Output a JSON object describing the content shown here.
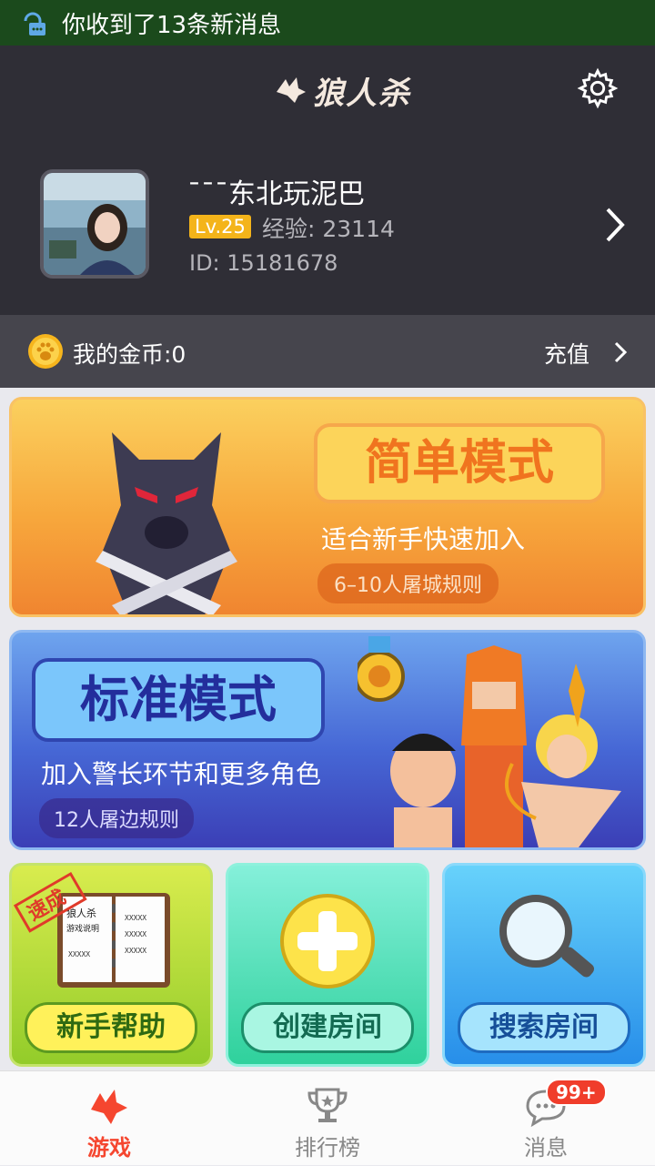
{
  "status_bar": {
    "notification": "你收到了13条新消息"
  },
  "header": {
    "logo_text": "狼人杀",
    "profile": {
      "nickname": "¯¯¯东北玩泥巴",
      "level": "Lv.25",
      "experience": "经验: 23114",
      "user_id": "ID: 15181678"
    }
  },
  "coins": {
    "label": "我的金币:0",
    "recharge": "充值"
  },
  "modes": {
    "simple": {
      "title": "简单模式",
      "subtitle": "适合新手快速加入",
      "rule": "6–10人屠城规则"
    },
    "standard": {
      "title": "标准模式",
      "subtitle": "加入警长环节和更多角色",
      "rule": "12人屠边规则"
    }
  },
  "tiles": {
    "help": {
      "label": "新手帮助",
      "stamp": "速成",
      "book_title": "狼人杀",
      "book_subtitle": "游戏说明",
      "book_text": "XXXXX"
    },
    "create": {
      "label": "创建房间"
    },
    "search": {
      "label": "搜索房间"
    }
  },
  "tabbar": {
    "game": "游戏",
    "rank": "排行榜",
    "messages": "消息",
    "messages_badge": "99+"
  },
  "colors": {
    "header_bg": "#2f2e36",
    "coinbar_bg": "#46454d",
    "active_tab": "#f5462f",
    "level_badge": "#f4b41a",
    "status_bar": "#1b4a1c"
  }
}
